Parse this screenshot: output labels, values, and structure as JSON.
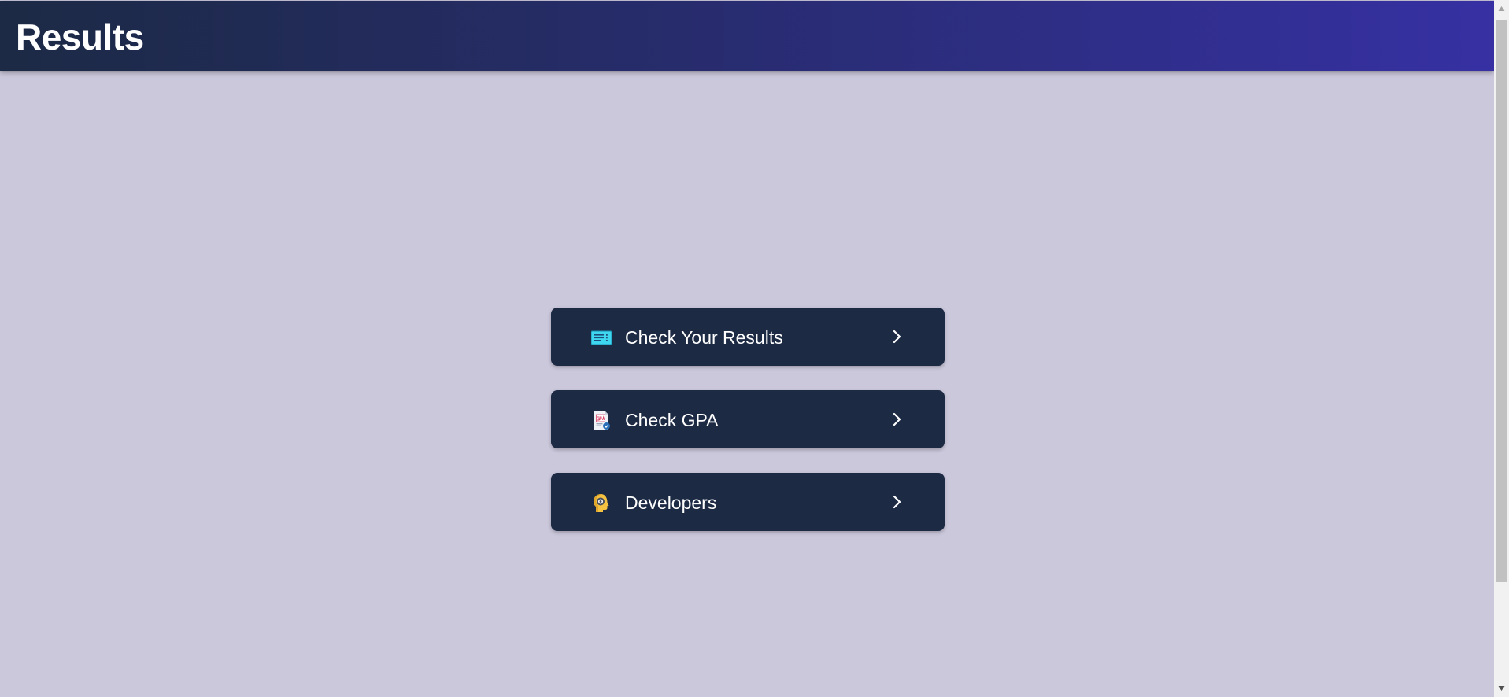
{
  "header": {
    "title": "Results"
  },
  "menu": {
    "items": [
      {
        "label": "Check Your Results",
        "icon": "results-card-icon"
      },
      {
        "label": "Check GPA",
        "icon": "gpa-document-icon"
      },
      {
        "label": "Developers",
        "icon": "developer-head-icon"
      }
    ]
  },
  "colors": {
    "background": "#cbc8dc",
    "header_start": "#1c2a45",
    "header_end": "#3630a3",
    "button": "#1c2a44",
    "text": "#ffffff"
  }
}
